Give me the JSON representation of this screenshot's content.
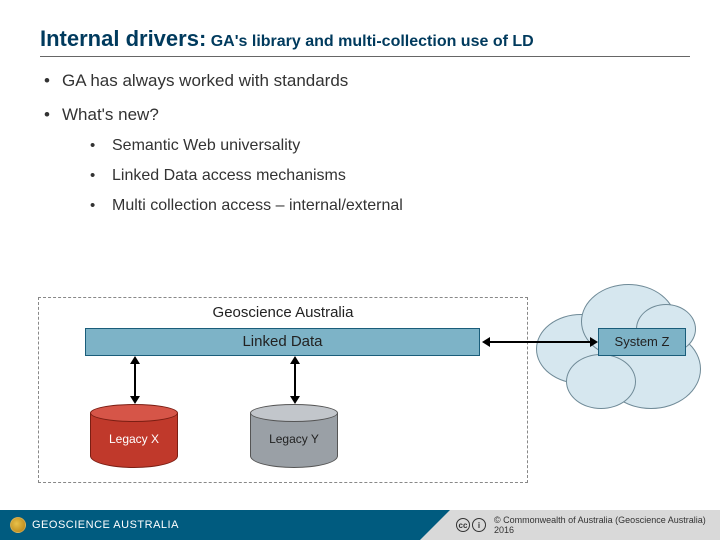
{
  "title": {
    "main": "Internal drivers:",
    "sub": "GA's library and multi-collection use of LD"
  },
  "bullets": {
    "b1": "GA has always worked with standards",
    "b2": "What's new?",
    "sub": {
      "s1": "Semantic Web universality",
      "s2": "Linked Data access mechanisms",
      "s3": "Multi collection access – internal/external"
    }
  },
  "diagram": {
    "container": "Geoscience Australia",
    "linked": "Linked Data",
    "legacyX": "Legacy X",
    "legacyY": "Legacy Y",
    "systemZ": "System Z"
  },
  "footer": {
    "brand": "GEOSCIENCE AUSTRALIA",
    "copyright": "© Commonwealth of Australia (Geoscience Australia) 2016",
    "cc1": "cc",
    "cc2": "i"
  },
  "colors": {
    "accent": "#005b7f",
    "ldFill": "#7db3c7",
    "legacyX": "#c0392b",
    "legacyY": "#9aa0a6",
    "cloud": "#d6e7ef"
  }
}
